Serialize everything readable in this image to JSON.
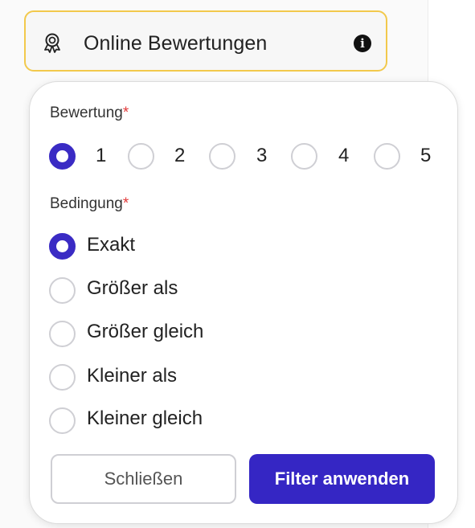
{
  "header": {
    "title": "Online Bewertungen",
    "icon": "award-badge-icon",
    "info_glyph": "i"
  },
  "colors": {
    "accent": "#3526c4",
    "chip_border": "#f2c94c",
    "required": "#e23b3b"
  },
  "rating": {
    "label": "Bewertung",
    "required_mark": "*",
    "selected": "1",
    "options": [
      "1",
      "2",
      "3",
      "4",
      "5"
    ]
  },
  "condition": {
    "label": "Bedingung",
    "required_mark": "*",
    "selected": "Exakt",
    "options": [
      "Exakt",
      "Größer als",
      "Größer gleich",
      "Kleiner als",
      "Kleiner gleich"
    ]
  },
  "buttons": {
    "close": "Schließen",
    "apply": "Filter anwenden"
  }
}
